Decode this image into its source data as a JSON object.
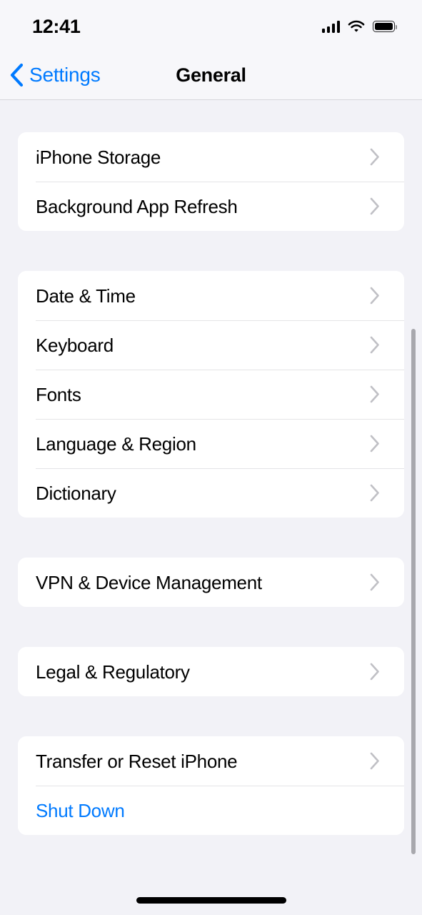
{
  "status_bar": {
    "time": "12:41",
    "signal_icon": "cellular-signal-icon",
    "signal_bars_filled": 4,
    "wifi_icon": "wifi-icon",
    "battery_icon": "battery-icon",
    "battery_level_percent": 100
  },
  "nav_bar": {
    "back_icon": "chevron-left-icon",
    "back_label": "Settings",
    "title": "General"
  },
  "colors": {
    "accent_blue": "#007AFF",
    "page_background": "#F2F2F7",
    "card_background": "#FFFFFF",
    "separator": "#E4E4E6",
    "chevron_gray": "#C0C0C5",
    "scrollbar": "#A8A8AD"
  },
  "groups": [
    {
      "rows": [
        {
          "label": "iPhone Storage",
          "accessory": "chevron-right-icon",
          "style": "default"
        },
        {
          "label": "Background App Refresh",
          "accessory": "chevron-right-icon",
          "style": "default"
        }
      ]
    },
    {
      "rows": [
        {
          "label": "Date & Time",
          "accessory": "chevron-right-icon",
          "style": "default"
        },
        {
          "label": "Keyboard",
          "accessory": "chevron-right-icon",
          "style": "default"
        },
        {
          "label": "Fonts",
          "accessory": "chevron-right-icon",
          "style": "default"
        },
        {
          "label": "Language & Region",
          "accessory": "chevron-right-icon",
          "style": "default"
        },
        {
          "label": "Dictionary",
          "accessory": "chevron-right-icon",
          "style": "default"
        }
      ]
    },
    {
      "rows": [
        {
          "label": "VPN & Device Management",
          "accessory": "chevron-right-icon",
          "style": "default"
        }
      ]
    },
    {
      "rows": [
        {
          "label": "Legal & Regulatory",
          "accessory": "chevron-right-icon",
          "style": "default"
        }
      ]
    },
    {
      "rows": [
        {
          "label": "Transfer or Reset iPhone",
          "accessory": "chevron-right-icon",
          "style": "default"
        },
        {
          "label": "Shut Down",
          "accessory": "none",
          "style": "accent"
        }
      ]
    }
  ],
  "scrollbar": {
    "visible": true
  },
  "home_indicator": {
    "visible": true
  }
}
